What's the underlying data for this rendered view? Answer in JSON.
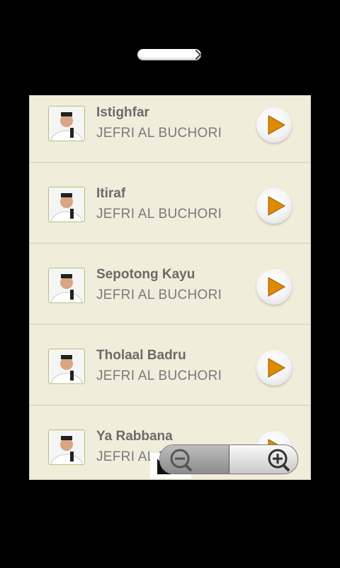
{
  "songs": [
    {
      "title": "Istighfar",
      "artist": "JEFRI AL BUCHORI"
    },
    {
      "title": "Itiraf",
      "artist": "JEFRI AL BUCHORI"
    },
    {
      "title": "Sepotong Kayu",
      "artist": "JEFRI AL BUCHORI"
    },
    {
      "title": "Tholaal Badru",
      "artist": "JEFRI AL BUCHORI"
    },
    {
      "title": "Ya Rabbana",
      "artist": "JEFRI AL BUCHORI"
    }
  ],
  "icons": {
    "thumbnail": "singer-photo-icon",
    "play": "play-icon",
    "zoom_out": "zoom-out-icon",
    "zoom_in": "zoom-in-icon"
  },
  "colors": {
    "background": "#000000",
    "row": "#f1eddb",
    "play_triangle": "#e08a00",
    "title_text": "#6b6b6b"
  }
}
